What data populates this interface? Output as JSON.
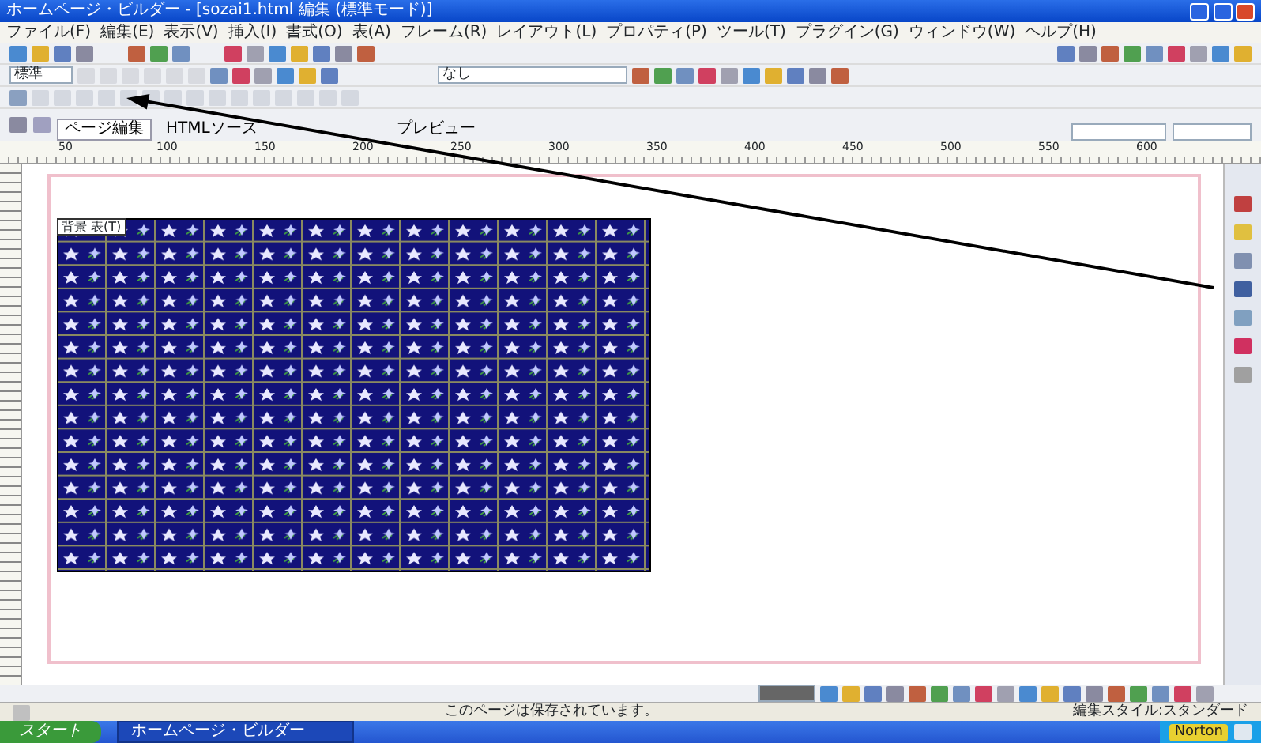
{
  "window": {
    "title": "ホームページ・ビルダー - [sozai1.html 編集 (標準モード)]"
  },
  "menu": [
    "ファイル(F)",
    "編集(E)",
    "表示(V)",
    "挿入(I)",
    "書式(O)",
    "表(A)",
    "フレーム(R)",
    "レイアウト(L)",
    "プロパティ(P)",
    "ツール(T)",
    "プラグイン(G)",
    "ウィンドウ(W)",
    "ヘルプ(H)"
  ],
  "toolbar": {
    "style_select": "標準",
    "font_select": "なし"
  },
  "view_tabs": [
    {
      "label": "ページ編集",
      "selected": true
    },
    {
      "label": "HTMLソース",
      "selected": false
    },
    {
      "label": "プレビュー",
      "selected": false
    }
  ],
  "ruler": {
    "labels": [
      "50",
      "100",
      "150",
      "200",
      "250",
      "300",
      "350",
      "400",
      "450",
      "500",
      "550",
      "600"
    ]
  },
  "page": {
    "table_label": "背景 表(T)"
  },
  "status_bar": {
    "message": "このページは保存されています。",
    "mode": "編集スタイル:スタンダード"
  },
  "taskbar": {
    "start": "スタート",
    "windows": [
      {
        "label": "ホームページ・ビルダー",
        "selected": true
      }
    ],
    "tray": "Norton"
  }
}
